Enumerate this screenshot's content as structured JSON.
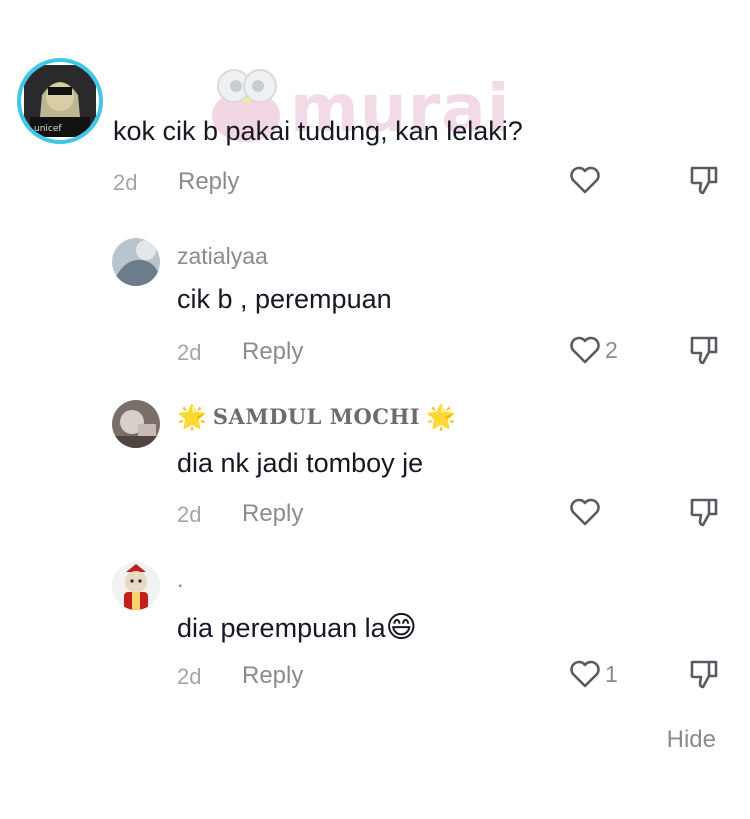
{
  "watermark": {
    "text": "murai"
  },
  "comments": [
    {
      "text": "kok cik b pakai tudung, kan lelaki?",
      "date": "2d",
      "reply": "Reply",
      "likes": ""
    },
    {
      "username": "zatialyaa",
      "text": "cik b , perempuan",
      "date": "2d",
      "reply": "Reply",
      "likes": "2"
    },
    {
      "username": "SAMDUL MOCHI",
      "username_decoration": "🌟",
      "text": "dia nk jadi tomboy je",
      "date": "2d",
      "reply": "Reply",
      "likes": ""
    },
    {
      "username": ".",
      "text": "dia perempuan la",
      "text_emoji": "😄",
      "date": "2d",
      "reply": "Reply",
      "likes": "1"
    }
  ],
  "hide_label": "Hide",
  "colors": {
    "accent_ring": "#3ec7e6",
    "text": "#161823",
    "muted": "#8a8b91",
    "icon": "#5a5b62"
  },
  "icons": [
    "heart-icon",
    "thumbs-down-icon",
    "star-icon"
  ]
}
